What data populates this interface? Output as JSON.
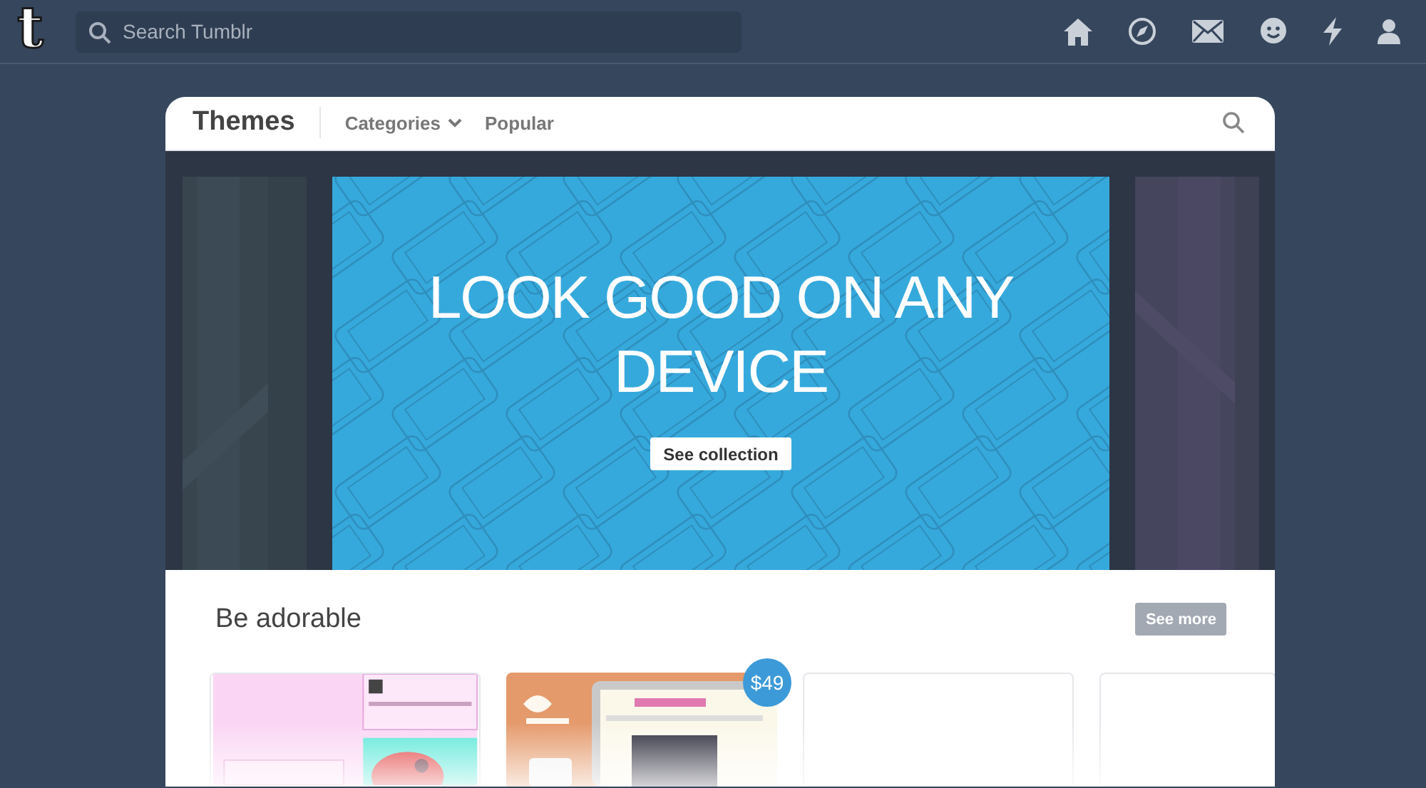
{
  "topbar": {
    "logo": "t",
    "search": {
      "placeholder": "Search Tumblr"
    }
  },
  "header": {
    "title": "Themes",
    "nav": [
      {
        "label": "Categories",
        "has_dropdown": true
      },
      {
        "label": "Popular",
        "has_dropdown": false
      }
    ]
  },
  "hero": {
    "headline": "LOOK GOOD ON ANY DEVICE",
    "button": "See collection"
  },
  "section": {
    "title": "Be adorable",
    "button": "See more",
    "themes": [
      {
        "kind": "pink"
      },
      {
        "kind": "orange",
        "price": "$49"
      },
      {
        "kind": "blank"
      },
      {
        "kind": "blank"
      }
    ]
  }
}
